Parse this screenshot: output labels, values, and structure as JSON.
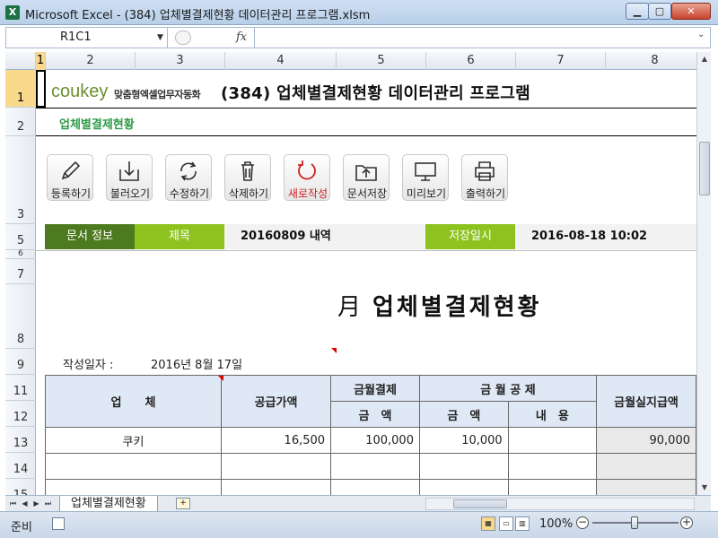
{
  "window": {
    "app_icon": "X",
    "title": "Microsoft Excel - (384) 업체별결제현황 데이터관리 프로그램.xlsm",
    "min_glyph": "▁",
    "max_glyph": "▢",
    "close_glyph": "✕"
  },
  "formula_bar": {
    "name_box": "R1C1",
    "fx": "fx",
    "value": ""
  },
  "columns": [
    "1",
    "2",
    "3",
    "4",
    "5",
    "6",
    "7",
    "8"
  ],
  "rows": [
    "1",
    "2",
    "3",
    "5",
    "6",
    "7",
    "8",
    "9",
    "11",
    "12",
    "13",
    "14",
    "15"
  ],
  "header": {
    "logo_brand": "cou",
    "logo_key": "key",
    "logo_tagline": "맞춤형엑셀업무자동화",
    "title": "(384) 업체별결제현황 데이터관리 프로그램",
    "section": "업체별결제현황"
  },
  "toolbar": [
    {
      "label": "등록하기",
      "icon": "pencil-icon"
    },
    {
      "label": "불러오기",
      "icon": "load-tray-icon"
    },
    {
      "label": "수정하기",
      "icon": "refresh-arrows-icon"
    },
    {
      "label": "삭제하기",
      "icon": "trash-icon"
    },
    {
      "label": "새로작성",
      "icon": "new-circle-arrow-icon"
    },
    {
      "label": "문서저장",
      "icon": "folder-upload-icon"
    },
    {
      "label": "미리보기",
      "icon": "monitor-icon"
    },
    {
      "label": "출력하기",
      "icon": "printer-icon"
    }
  ],
  "info": {
    "doc_label": "문서 정보",
    "title_label": "제목",
    "title_value": "20160809 내역",
    "saved_label": "저장일시",
    "saved_value": "2016-08-18 10:02"
  },
  "document": {
    "month_glyph": "月",
    "title": "업체별결제현황",
    "date_label": "작성일자 :",
    "date_value": "2016년 8월 17일"
  },
  "table": {
    "h_company": "업　　체",
    "h_supply": "공급가액",
    "h_monthly_pay": "금월결제",
    "h_deduction": "금 월 공 제",
    "h_net_pay": "금월실지급액",
    "h_amount1": "금　액",
    "h_amount2": "금　액",
    "h_content": "내　용",
    "rows": [
      {
        "company": "쿠키",
        "supply": "16,500",
        "monthly_pay": "100,000",
        "deduction_amount": "10,000",
        "deduction_content": "",
        "net_pay": "90,000"
      }
    ]
  },
  "tabs": {
    "sheet": "업체별결제현황",
    "nav_first": "⏮",
    "nav_prev": "◀",
    "nav_next": "▶",
    "nav_last": "⏭"
  },
  "status": {
    "ready": "준비",
    "zoom": "100%"
  },
  "colors": {
    "dark_green": "#4e7a1f",
    "light_green": "#8dc21f",
    "section_green": "#2e9a46",
    "header_blue": "#dfe9f5"
  }
}
